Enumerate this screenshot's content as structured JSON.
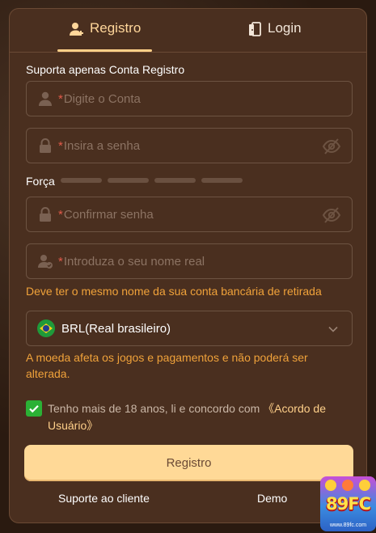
{
  "tabs": [
    {
      "label": "Registro",
      "icon": "add-user-icon",
      "active": true
    },
    {
      "label": "Login",
      "icon": "login-door-icon",
      "active": false
    }
  ],
  "form": {
    "account_section_label": "Suporta apenas Conta Registro",
    "account_placeholder": "Digite o Conta",
    "password_placeholder": "Insira a senha",
    "strength_label": "Força",
    "confirm_placeholder": "Confirmar senha",
    "realname_placeholder": "Introduza o seu nome real",
    "realname_hint": "Deve ter o mesmo nome da sua conta bancária de retirada",
    "currency_value": "BRL(Real brasileiro)",
    "currency_hint": "A moeda afeta os jogos e pagamentos e não poderá ser alterada.",
    "required_mark": "*",
    "agree_text": "Tenho mais de 18 anos, li e concordo com",
    "agree_link": "《Acordo de Usuário》",
    "agree_checked": true,
    "submit_label": "Registro"
  },
  "footer": {
    "support_label": "Suporte ao cliente",
    "demo_label": "Demo"
  },
  "badge": {
    "logo_text": "89FC",
    "url_text": "www.89fc.com"
  },
  "colors": {
    "panel_bg": "#4a2f1f",
    "accent": "#ffd69a",
    "button_bg": "#ffd997",
    "hint": "#f0a23a",
    "checkbox": "#2bb135"
  }
}
